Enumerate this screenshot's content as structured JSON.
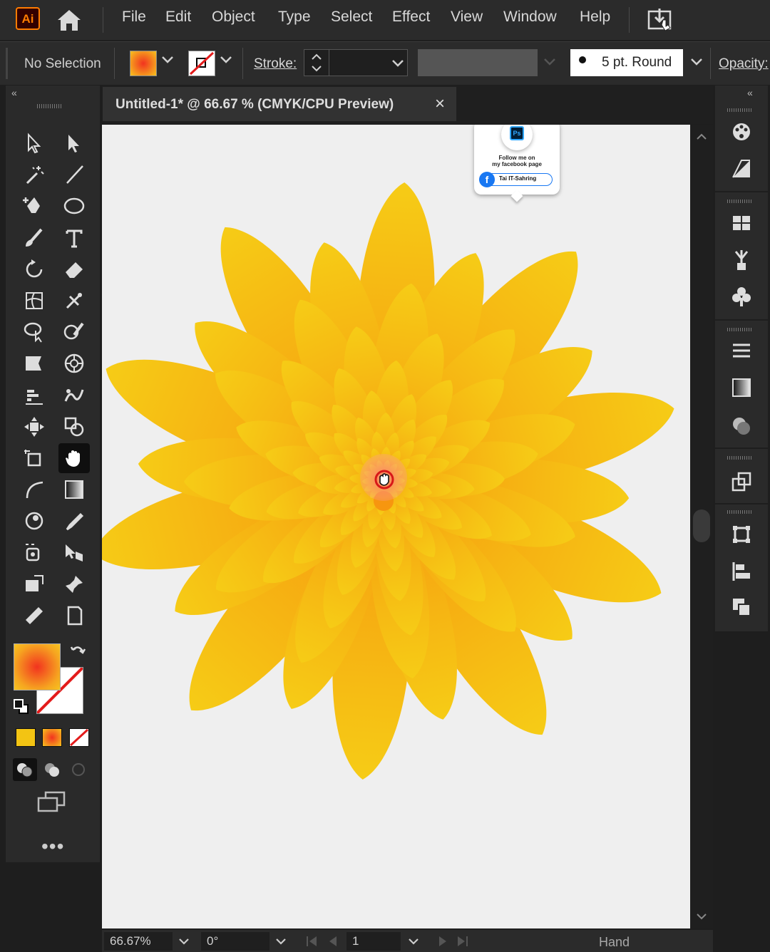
{
  "app": {
    "logo_text": "Ai",
    "brand_color": "#ff7c00"
  },
  "menu": {
    "items": [
      "File",
      "Edit",
      "Object",
      "Type",
      "Select",
      "Effect",
      "View",
      "Window",
      "Help"
    ]
  },
  "control": {
    "selection_label": "No Selection",
    "stroke_label": "Stroke:",
    "brush_label": "5 pt. Round",
    "opacity_label": "Opacity:"
  },
  "document": {
    "tab_title": "Untitled-1* @ 66.67 % (CMYK/CPU Preview)",
    "close_glyph": "×"
  },
  "watermark": {
    "badge_text": "Ps",
    "line1": "Follow me on",
    "line2": "my facebook page",
    "page_name": "Tai IT-Sahring"
  },
  "statusbar": {
    "zoom": "66.67%",
    "rotation": "0°",
    "artboard_number": "1",
    "current_tool": "Hand"
  },
  "colors": {
    "fill_gradient_inner": "#f2331f",
    "fill_gradient_outer": "#f7c41e",
    "petal_light": "#f6cc16",
    "petal_dark": "#f7960f",
    "swatch_yellow": "#f3c413",
    "none_slash": "#e31b1b"
  },
  "icons": {
    "toolbar": [
      "selection-icon",
      "direct-selection-icon",
      "magic-wand-icon",
      "line-segment-icon",
      "pen-icon",
      "ellipse-icon",
      "paintbrush-icon",
      "type-icon",
      "rotate-icon",
      "eraser-icon",
      "mesh-icon",
      "puppet-warp-icon",
      "lasso-icon",
      "shaper-icon",
      "live-paint-icon",
      "symbol-sprayer-icon",
      "graph-icon",
      "blend-icon",
      "free-transform-icon",
      "shape-builder-icon",
      "artboard-icon",
      "hand-icon",
      "curvature-icon",
      "gradient-icon",
      "perspective-icon",
      "eyedropper-icon",
      "image-trace-icon",
      "live-paint-select-icon",
      "slice-icon",
      "pin-icon",
      "measure-icon",
      "page-icon"
    ]
  }
}
